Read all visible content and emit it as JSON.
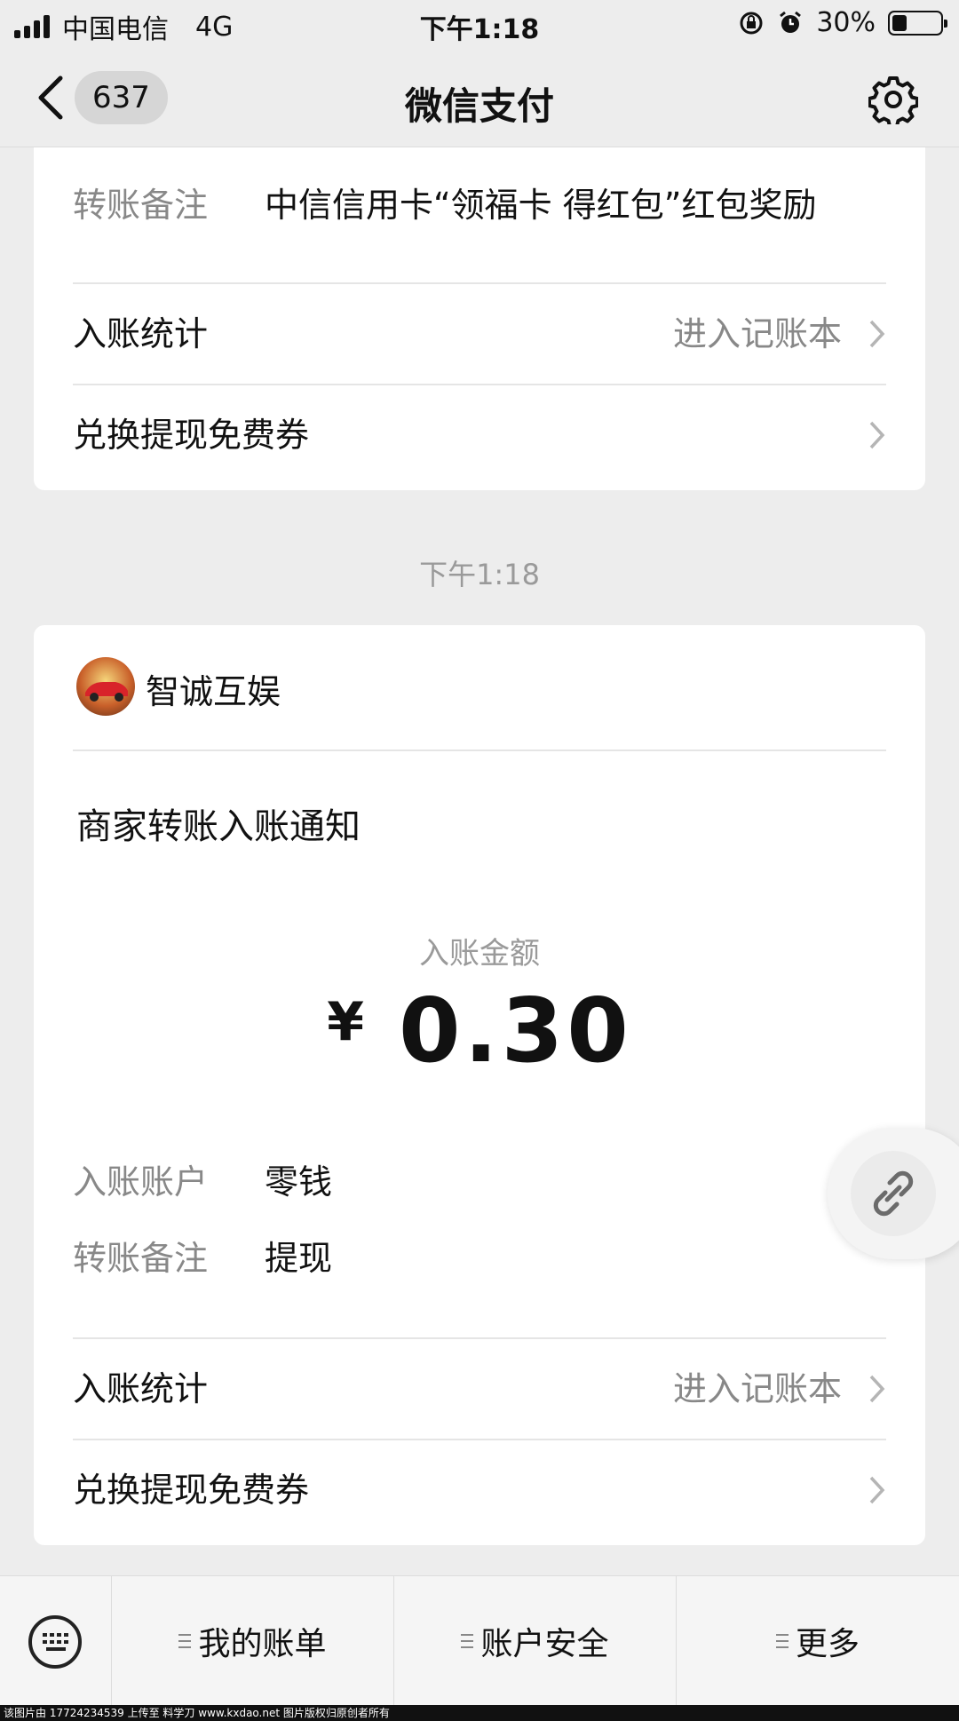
{
  "status_bar": {
    "carrier": "中国电信",
    "network": "4G",
    "time": "下午1:18",
    "battery": "30%"
  },
  "nav": {
    "unread_count": "637",
    "title": "微信支付"
  },
  "card1": {
    "remark_label": "转账备注",
    "remark_value": "中信信用卡“领福卡 得红包”红包奖励",
    "stats_label": "入账统计",
    "stats_link": "进入记账本",
    "coupon_label": "兑换提现免费券"
  },
  "timestamp": "下午1:18",
  "card2": {
    "merchant_name": "智诚互娱",
    "notice_title": "商家转账入账通知",
    "amount_label": "入账金额",
    "currency": "¥",
    "amount": "0.30",
    "account_label": "入账账户",
    "account_value": "零钱",
    "remark_label": "转账备注",
    "remark_value": "提现",
    "stats_label": "入账统计",
    "stats_link": "进入记账本",
    "coupon_label": "兑换提现免费券"
  },
  "bottom_menu": {
    "items": [
      "我的账单",
      "账户安全",
      "更多"
    ]
  },
  "watermark": "该图片由 17724234539 上传至 料学刀 www.kxdao.net 图片版权归原创者所有"
}
